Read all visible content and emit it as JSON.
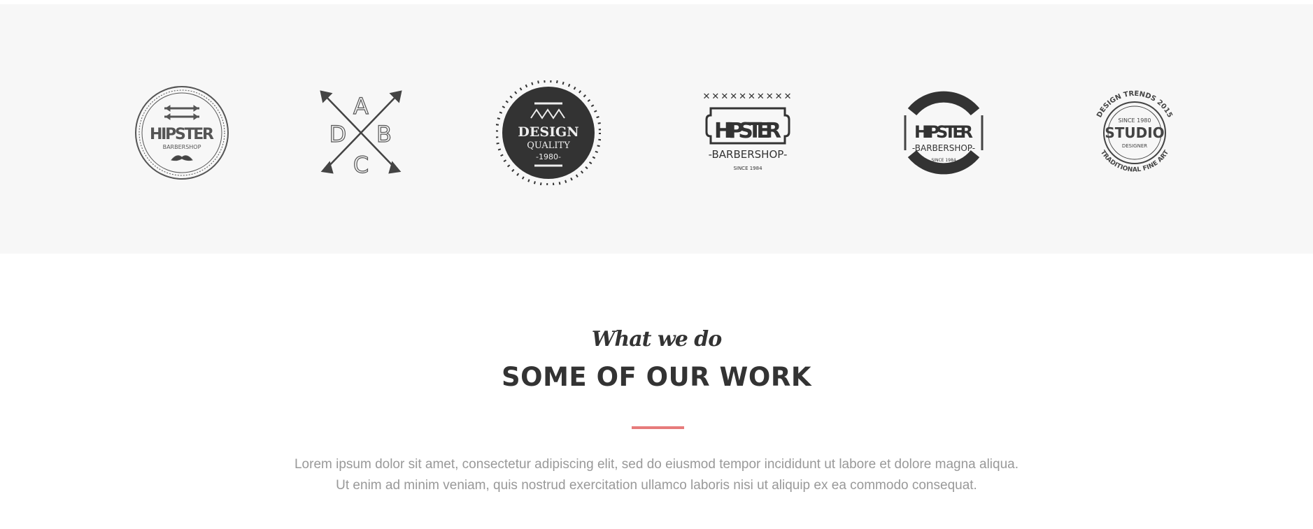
{
  "logos": [
    {
      "name": "hipster-barbershop-mustache",
      "text": [
        "HIPSTER",
        "BARBERSHOP"
      ]
    },
    {
      "name": "abcd-arrows",
      "text": [
        "A",
        "B",
        "C",
        "D"
      ]
    },
    {
      "name": "design-quality",
      "text": [
        "DESIGN",
        "QUALITY",
        "-1980-"
      ]
    },
    {
      "name": "hipster-barbershop-banner",
      "text": [
        "HIPSTER",
        "-BARBERSHOP-",
        "SINCE 1984"
      ]
    },
    {
      "name": "hipster-barbershop-ring",
      "text": [
        "HIPSTER",
        "-BARBERSHOP-",
        "SINCE 1984"
      ]
    },
    {
      "name": "studio-designer",
      "text": [
        "DESIGN TRENDS 2015",
        "SINCE 1980",
        "STUDIO",
        "DESIGNER",
        "TRADITIONAL FINE ART"
      ]
    }
  ],
  "section": {
    "subtitle": "What we do",
    "title": "SOME OF OUR WORK",
    "accent_color": "#e77b7b",
    "lines": [
      "Lorem ipsum dolor sit amet, consectetur adipiscing elit, sed do eiusmod tempor incididunt ut labore et dolore magna aliqua.",
      "Ut enim ad minim veniam, quis nostrud exercitation ullamco laboris nisi ut aliquip ex ea commodo consequat."
    ]
  }
}
